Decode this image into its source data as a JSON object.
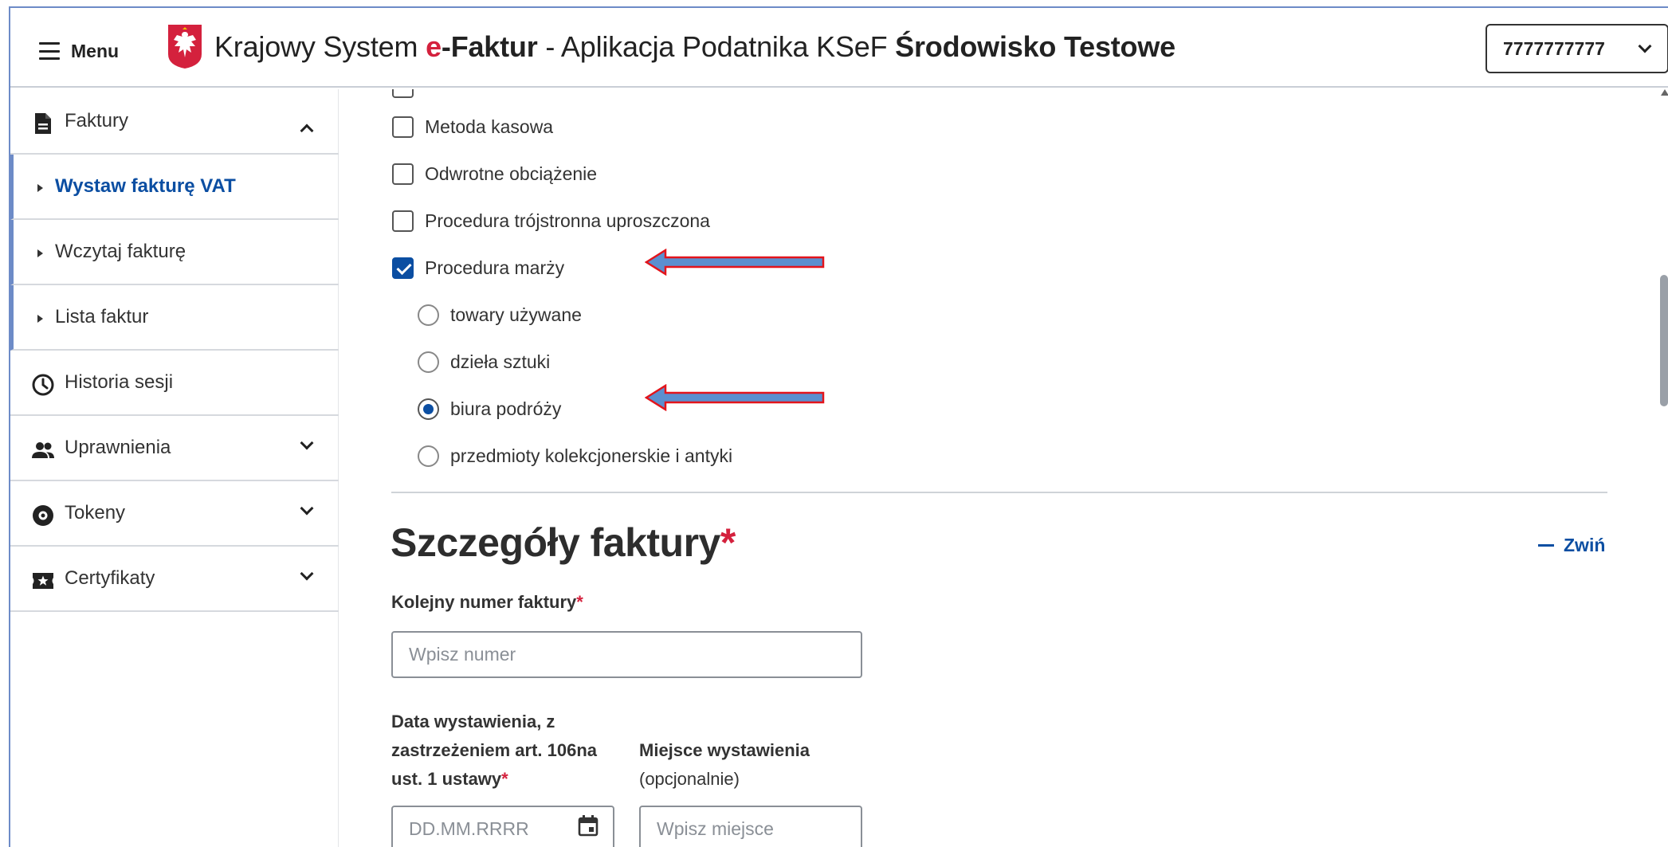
{
  "header": {
    "menu_label": "Menu",
    "title_prefix": "Krajowy System",
    "title_brand_e": "e",
    "title_brand_rest": "-Faktur",
    "title_middle": " - Aplikacja Podatnika KSeF ",
    "title_env": "Środowisko Testowe",
    "nip_value": "7777777777"
  },
  "sidebar": {
    "items": [
      {
        "label": "Faktury",
        "icon": "document-icon"
      },
      {
        "label": "Wystaw fakturę VAT"
      },
      {
        "label": "Wczytaj fakturę"
      },
      {
        "label": "Lista faktur"
      },
      {
        "label": "Historia sesji",
        "icon": "clock-icon"
      },
      {
        "label": "Uprawnienia",
        "icon": "users-icon"
      },
      {
        "label": "Tokeny",
        "icon": "token-icon"
      },
      {
        "label": "Certyfikaty",
        "icon": "certificate-icon"
      }
    ]
  },
  "options": {
    "checkboxes": [
      {
        "label": "Metoda kasowa",
        "checked": false
      },
      {
        "label": "Odwrotne obciążenie",
        "checked": false
      },
      {
        "label": "Procedura trójstronna uproszczona",
        "checked": false
      },
      {
        "label": "Procedura marży",
        "checked": true
      }
    ],
    "radios": [
      {
        "label": "towary używane",
        "checked": false
      },
      {
        "label": "dzieła sztuki",
        "checked": false
      },
      {
        "label": "biura podróży",
        "checked": true
      },
      {
        "label": "przedmioty kolekcjonerskie i antyki",
        "checked": false
      }
    ]
  },
  "details": {
    "title": "Szczegóły faktury",
    "required_mark": "*",
    "collapse_label": "Zwiń",
    "invoice_number_label": "Kolejny numer faktury",
    "invoice_number_placeholder": "Wpisz numer",
    "issue_date_label_1": "Data wystawienia, z",
    "issue_date_label_2": "zastrzeżeniem art. 106na",
    "issue_date_label_3": "ust. 1 ustawy",
    "issue_date_placeholder": "DD.MM.RRRR",
    "place_label": "Miejsce wystawienia",
    "place_note": "(opcjonalnie)",
    "place_placeholder": "Wpisz miejsce"
  },
  "colors": {
    "accent": "#0b4ea2",
    "required": "#d4213d",
    "arrow_fill": "#5b8fcf",
    "arrow_stroke": "#e3141b"
  }
}
